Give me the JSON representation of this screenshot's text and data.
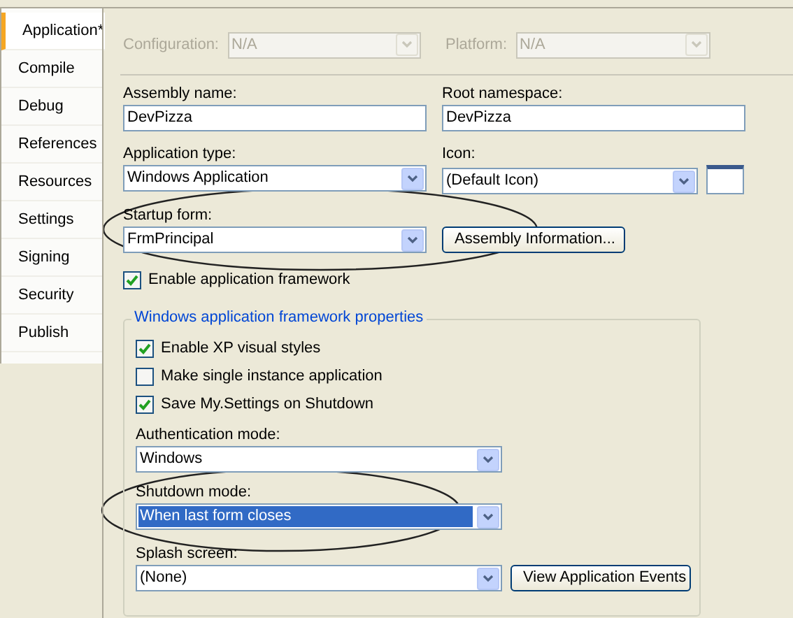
{
  "tabs": [
    {
      "label": "Application*",
      "selected": true
    },
    {
      "label": "Compile",
      "selected": false
    },
    {
      "label": "Debug",
      "selected": false
    },
    {
      "label": "References",
      "selected": false
    },
    {
      "label": "Resources",
      "selected": false
    },
    {
      "label": "Settings",
      "selected": false
    },
    {
      "label": "Signing",
      "selected": false
    },
    {
      "label": "Security",
      "selected": false
    },
    {
      "label": "Publish",
      "selected": false
    }
  ],
  "configuration": {
    "label": "Configuration:",
    "value": "N/A",
    "disabled": true
  },
  "platform": {
    "label": "Platform:",
    "value": "N/A",
    "disabled": true
  },
  "assembly_name": {
    "label": "Assembly name:",
    "value": "DevPizza"
  },
  "root_namespace": {
    "label": "Root namespace:",
    "value": "DevPizza"
  },
  "application_type": {
    "label": "Application type:",
    "value": "Windows Application"
  },
  "icon": {
    "label": "Icon:",
    "value": "(Default Icon)"
  },
  "startup_form": {
    "label": "Startup form:",
    "value": "FrmPrincipal"
  },
  "assembly_information_button": "Assembly Information...",
  "enable_application_framework": {
    "label": "Enable application framework",
    "checked": true
  },
  "framework_group": {
    "title": "Windows application framework properties",
    "checkboxes": [
      {
        "label": "Enable XP visual styles",
        "checked": true
      },
      {
        "label": "Make single instance application",
        "checked": false
      },
      {
        "label": "Save My.Settings on Shutdown",
        "checked": true
      }
    ],
    "authentication_mode": {
      "label": "Authentication mode:",
      "value": "Windows",
      "selected": false
    },
    "shutdown_mode": {
      "label": "Shutdown mode:",
      "value": "When last form closes",
      "selected": true
    },
    "splash_screen": {
      "label": "Splash screen:",
      "value": "(None)",
      "selected": false
    },
    "view_events_button": "View Application Events"
  }
}
